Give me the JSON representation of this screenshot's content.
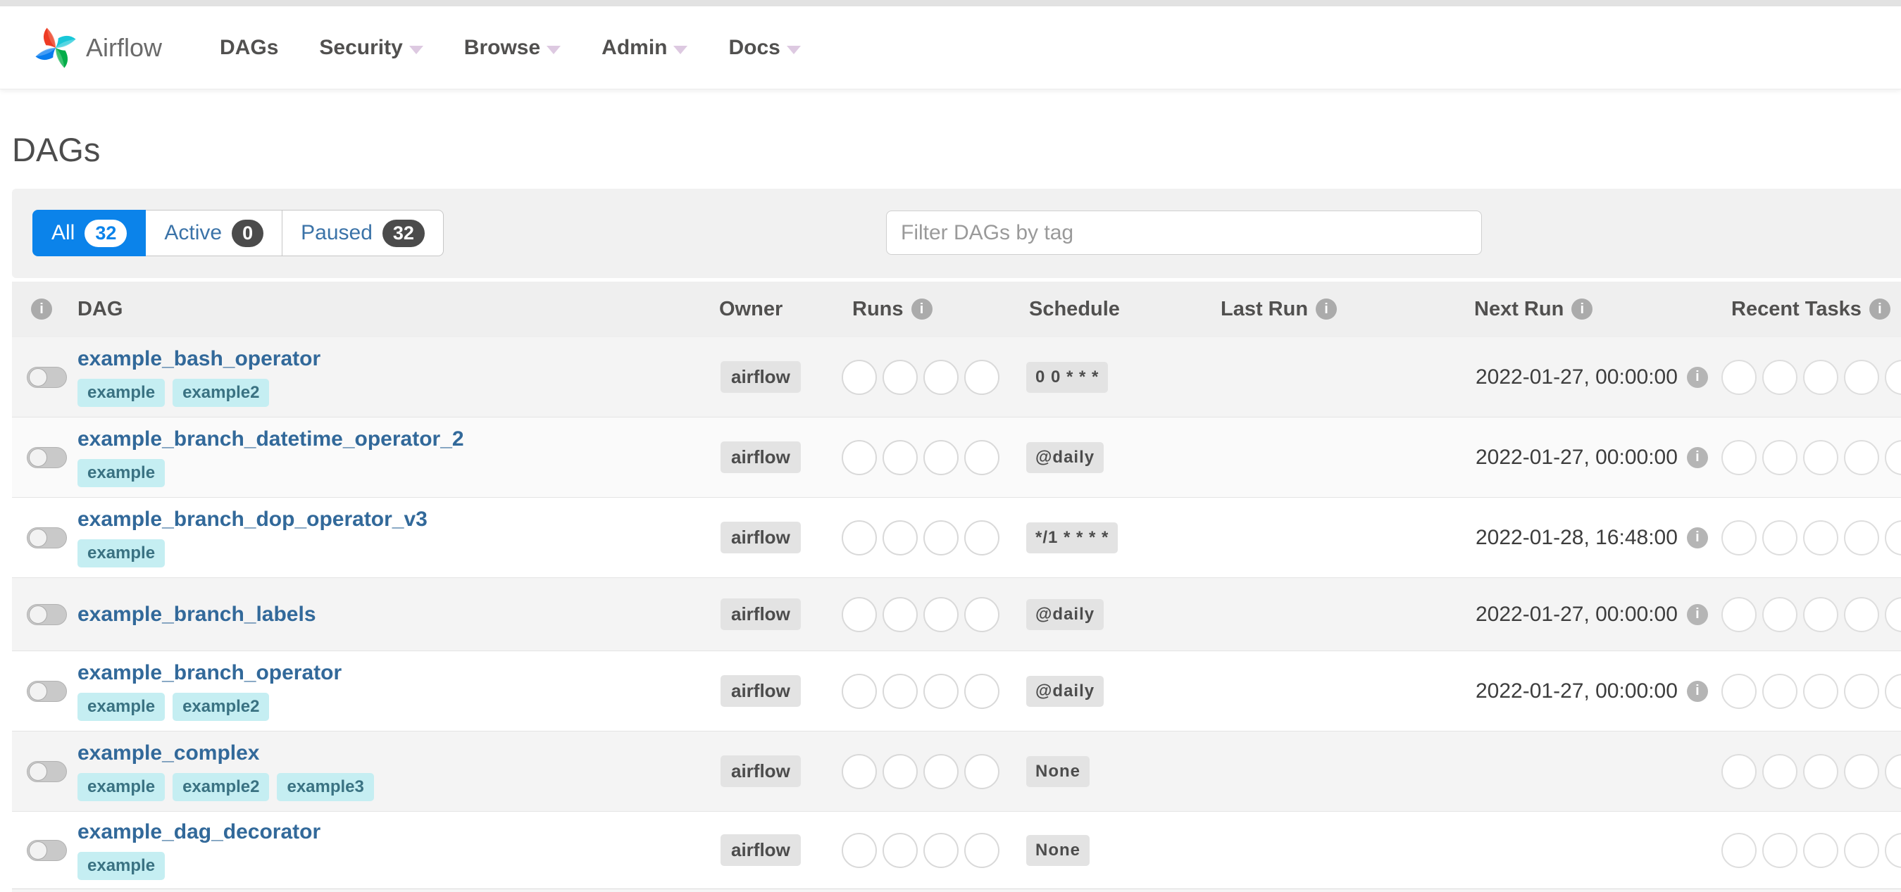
{
  "navbar": {
    "brand": "Airflow",
    "items": [
      {
        "label": "DAGs",
        "dropdown": false
      },
      {
        "label": "Security",
        "dropdown": true
      },
      {
        "label": "Browse",
        "dropdown": true
      },
      {
        "label": "Admin",
        "dropdown": true
      },
      {
        "label": "Docs",
        "dropdown": true
      }
    ]
  },
  "page": {
    "title": "DAGs"
  },
  "filters": {
    "tabs": [
      {
        "label": "All",
        "count": "32",
        "active": true
      },
      {
        "label": "Active",
        "count": "0",
        "active": false
      },
      {
        "label": "Paused",
        "count": "32",
        "active": false
      }
    ],
    "search_placeholder": "Filter DAGs by tag"
  },
  "table": {
    "headers": {
      "dag": "DAG",
      "owner": "Owner",
      "runs": "Runs",
      "schedule": "Schedule",
      "last_run": "Last Run",
      "next_run": "Next Run",
      "recent_tasks": "Recent Tasks"
    },
    "runs_circle_count": 4,
    "recent_tasks_circle_count": 5,
    "rows": [
      {
        "name": "example_bash_operator",
        "tags": [
          "example",
          "example2"
        ],
        "owner": "airflow",
        "schedule": "0 0 * * *",
        "last_run": "",
        "next_run": "2022-01-27, 00:00:00",
        "paused": true
      },
      {
        "name": "example_branch_datetime_operator_2",
        "tags": [
          "example"
        ],
        "owner": "airflow",
        "schedule": "@daily",
        "last_run": "",
        "next_run": "2022-01-27, 00:00:00",
        "paused": true
      },
      {
        "name": "example_branch_dop_operator_v3",
        "tags": [
          "example"
        ],
        "owner": "airflow",
        "schedule": "*/1 * * * *",
        "last_run": "",
        "next_run": "2022-01-28, 16:48:00",
        "paused": true
      },
      {
        "name": "example_branch_labels",
        "tags": [],
        "owner": "airflow",
        "schedule": "@daily",
        "last_run": "",
        "next_run": "2022-01-27, 00:00:00",
        "paused": true
      },
      {
        "name": "example_branch_operator",
        "tags": [
          "example",
          "example2"
        ],
        "owner": "airflow",
        "schedule": "@daily",
        "last_run": "",
        "next_run": "2022-01-27, 00:00:00",
        "paused": true
      },
      {
        "name": "example_complex",
        "tags": [
          "example",
          "example2",
          "example3"
        ],
        "owner": "airflow",
        "schedule": "None",
        "last_run": "",
        "next_run": "",
        "paused": true
      },
      {
        "name": "example_dag_decorator",
        "tags": [
          "example"
        ],
        "owner": "airflow",
        "schedule": "None",
        "last_run": "",
        "next_run": "",
        "paused": true
      }
    ]
  },
  "colors": {
    "accent_blue": "#0b83ea",
    "tag_background": "#c5eef2",
    "tag_text": "#3a7282",
    "dag_link": "#32699a",
    "badge_gray": "#e3e3e3",
    "logo_red": "#ee3b24",
    "logo_teal": "#18c7d8",
    "logo_green": "#04ad49",
    "logo_blue": "#087cee"
  }
}
